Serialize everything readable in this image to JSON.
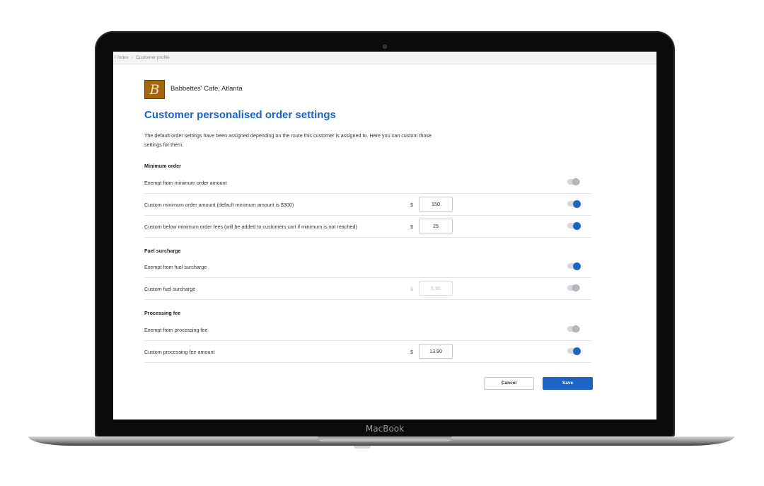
{
  "device": {
    "brand": "MacBook"
  },
  "breadcrumb": {
    "items": [
      "r Index",
      "Customer profile"
    ],
    "separator": "›"
  },
  "customer": {
    "logo_letter": "B",
    "name": "Babbettes' Cafe, Atlanta"
  },
  "page": {
    "title": "Customer personalised order settings",
    "description": "The default order settings have been assigned depending on the route this customer is assigned to. Here you can custom those settings for them."
  },
  "colors": {
    "accent": "#1c63c4",
    "logo_bg": "#a5670e"
  },
  "sections": {
    "minimum": {
      "title": "Minimum order",
      "rows": [
        {
          "label": "Exempt from minimum order amount",
          "toggle": "off"
        },
        {
          "label": "Custom minimum order amount (default minimum amount is $300)",
          "currency": "$",
          "value": "150",
          "toggle": "on"
        },
        {
          "label": "Custom below minimum order fees (will be added to customers cart if minimum is not reached)",
          "currency": "$",
          "value": "25",
          "toggle": "on"
        }
      ]
    },
    "fuel": {
      "title": "Fuel surcharge",
      "rows": [
        {
          "label": "Exempt from fuel surcharge",
          "toggle": "on"
        },
        {
          "label": "Custom fuel surcharge",
          "currency": "$",
          "value": "5.95",
          "toggle": "off",
          "disabled": true
        }
      ]
    },
    "processing": {
      "title": "Processing fee",
      "rows": [
        {
          "label": "Exempt from processing  fee",
          "toggle": "off"
        },
        {
          "label": "Custom processing fee amount",
          "currency": "$",
          "value": "13.90",
          "toggle": "on"
        }
      ]
    }
  },
  "actions": {
    "cancel": "Cancel",
    "save": "Save"
  }
}
